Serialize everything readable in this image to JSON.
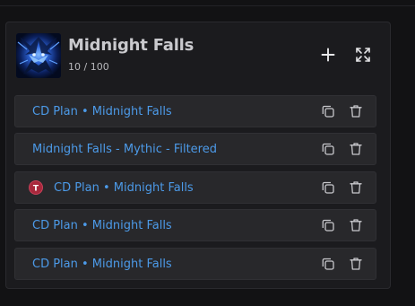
{
  "header": {
    "title": "Midnight Falls",
    "count": "10 / 100",
    "thumbnail": "dark-blue-fantasy-creature-art",
    "add_icon": "plus-icon",
    "expand_icon": "expand-icon"
  },
  "plans": [
    {
      "label": "CD Plan • Midnight Falls",
      "badge": false
    },
    {
      "label": "Midnight Falls - Mythic - Filtered",
      "badge": false
    },
    {
      "label": "CD Plan • Midnight Falls",
      "badge": true,
      "badge_letter": "T",
      "badge_color": "#a8283c"
    },
    {
      "label": "CD Plan • Midnight Falls",
      "badge": false
    },
    {
      "label": "CD Plan • Midnight Falls",
      "badge": false
    }
  ],
  "row_actions": {
    "copy_icon": "copy-icon",
    "delete_icon": "trash-icon"
  },
  "colors": {
    "link": "#4c9ae8",
    "panel": "#1b1b1e",
    "row": "#28282b",
    "badge": "#a8283c"
  }
}
